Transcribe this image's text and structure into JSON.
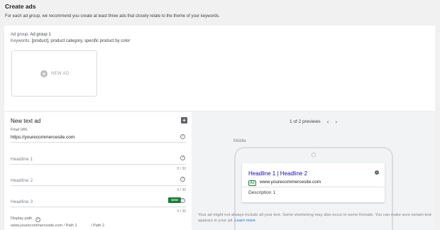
{
  "header": {
    "title": "Create ads",
    "subtitle": "For each ad group, we recommend you create at least three ads that closely relate to the theme of your keywords."
  },
  "adgroup": {
    "ad_group_label": "Ad group:",
    "ad_group_value": "Ad group 1",
    "keywords_label": "Keywords:",
    "keywords_value": "[product], product category, specific product by color",
    "new_ad_label": "NEW AD"
  },
  "form": {
    "title": "New text ad",
    "final_url_label": "Final URL",
    "final_url_value": "https://yourecommercesite.com",
    "headline1_placeholder": "Headline 1",
    "headline1_count": "0 / 30",
    "headline2_placeholder": "Headline 2",
    "headline2_count": "0 / 30",
    "headline3_placeholder": "Headline 3",
    "headline3_count": "0 / 30",
    "new_badge": "NEW",
    "display_path_label": "Display path",
    "display_path_base": "www.yourecommercesite.com / Path 1",
    "display_path_2": "/ Path 2"
  },
  "preview": {
    "pager_text": "1 of 2 previews",
    "mobile_label": "Mobile",
    "headline": "Headline 1 | Headline 2",
    "ad_badge": "Ad",
    "url": "www.yourecommercesite.com",
    "description": "Description 1",
    "disclaimer": "Your ad might not always include all your text. Some shortening may also occur in some formats. You can make sure certain text appears in your ad.",
    "learn_more": "Learn more"
  },
  "icons": {
    "plus": "plus-circle-icon",
    "help": "help-icon",
    "doc": "ad-doc-icon",
    "chev_left": "chevron-left-icon",
    "chev_right": "chevron-right-icon",
    "info": "info-icon"
  },
  "colors": {
    "link_blue": "#1a0dab",
    "accent_blue": "#1a73e8",
    "green": "#188038"
  }
}
